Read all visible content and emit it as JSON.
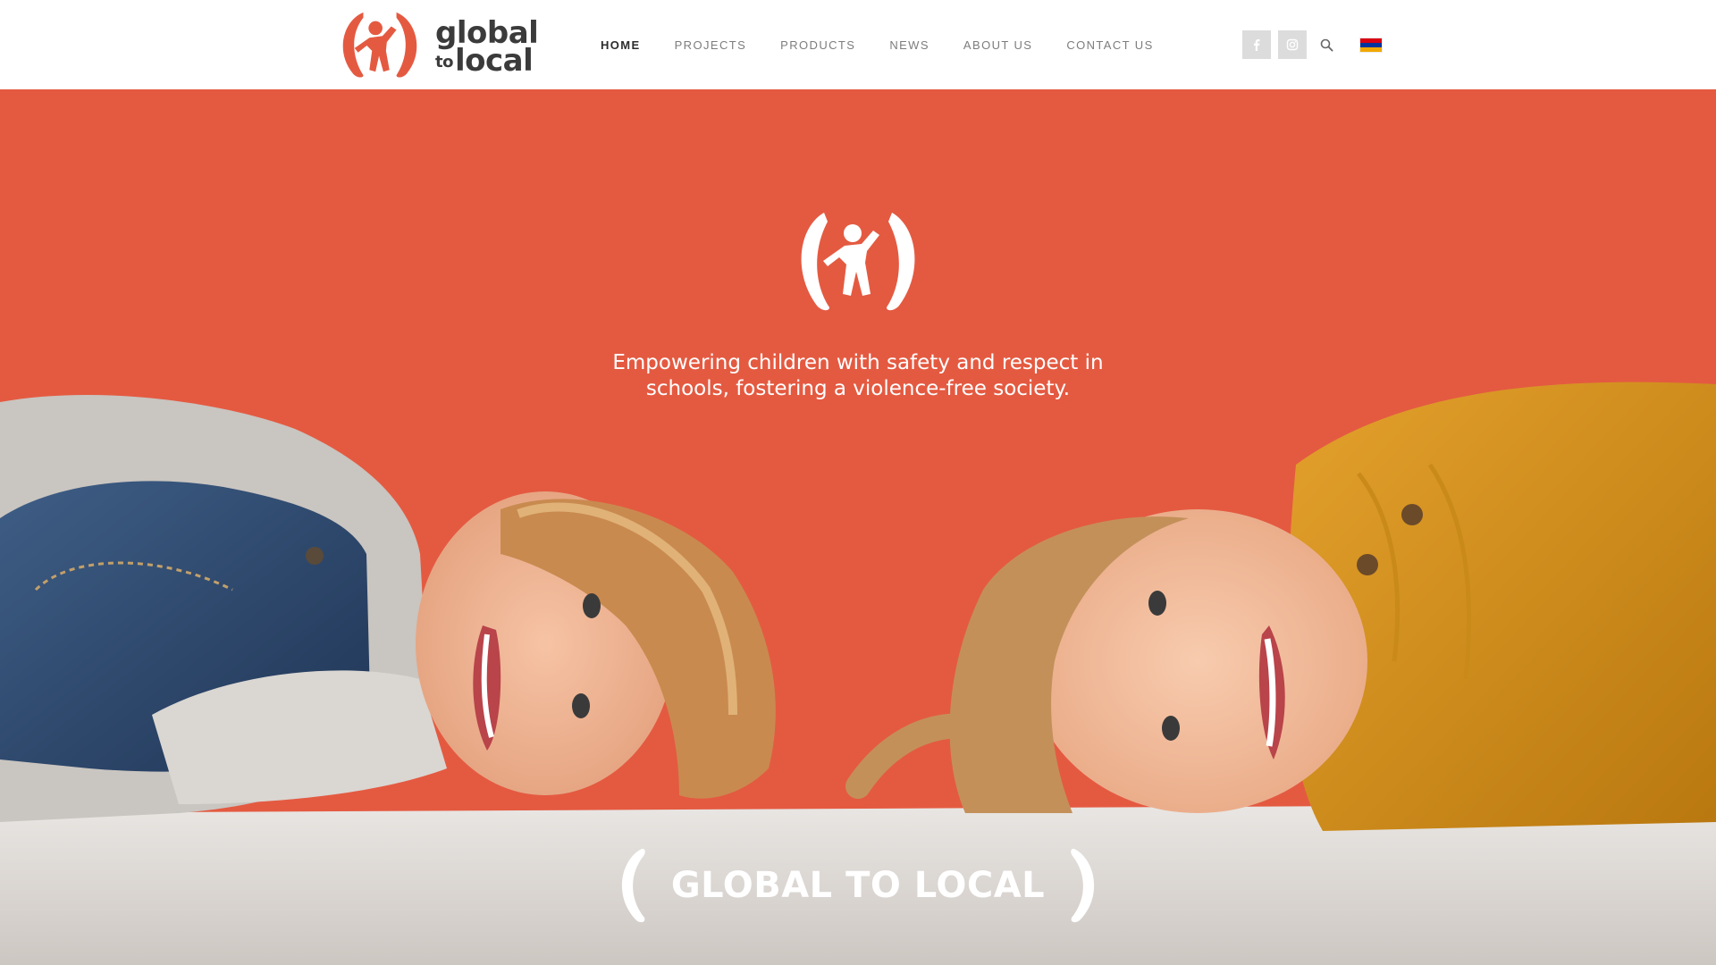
{
  "brand": {
    "name_line1": "global",
    "name_to": "to",
    "name_line2": "local",
    "accent_color": "#e45a41",
    "text_color": "#3b3b3b"
  },
  "nav": {
    "items": [
      {
        "label": "HOME",
        "active": true
      },
      {
        "label": "PROJECTS",
        "active": false
      },
      {
        "label": "PRODUCTS",
        "active": false
      },
      {
        "label": "NEWS",
        "active": false
      },
      {
        "label": "ABOUT US",
        "active": false
      },
      {
        "label": "CONTACT US",
        "active": false
      }
    ]
  },
  "tools": {
    "social": [
      {
        "icon": "facebook-icon"
      },
      {
        "icon": "instagram-icon"
      }
    ],
    "search_icon": "search-icon",
    "language_flag": {
      "icon": "armenian-flag-icon",
      "colors": [
        "#d90012",
        "#0033a0",
        "#f2a800"
      ]
    }
  },
  "hero": {
    "background_color": "#e45a41",
    "emblem_icon": "children-emblem-icon",
    "tagline_line1": "Empowering children with safety and respect in",
    "tagline_line2": "schools, fostering a violence-free society.",
    "title": "GLOBAL TO LOCAL"
  }
}
